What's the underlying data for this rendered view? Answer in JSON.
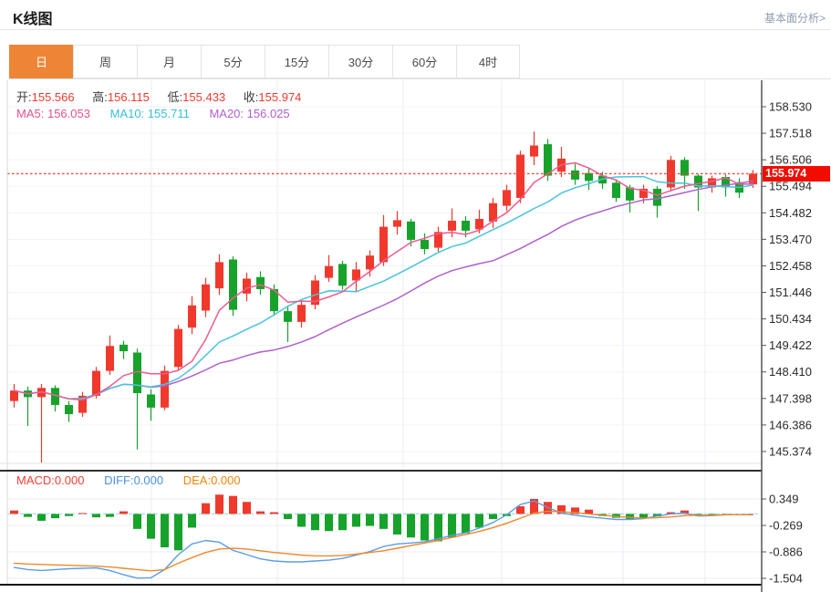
{
  "header": {
    "title": "K线图",
    "link": "基本面分析>"
  },
  "tabs": [
    {
      "label": "日",
      "selected": true
    },
    {
      "label": "周",
      "selected": false
    },
    {
      "label": "月",
      "selected": false
    },
    {
      "label": "5分",
      "selected": false
    },
    {
      "label": "15分",
      "selected": false
    },
    {
      "label": "30分",
      "selected": false
    },
    {
      "label": "60分",
      "selected": false
    },
    {
      "label": "4时",
      "selected": false
    }
  ],
  "ohlc": {
    "o_label": "开:",
    "o": "155.566",
    "h_label": "高:",
    "h": "156.115",
    "l_label": "低:",
    "l": "155.433",
    "c_label": "收:",
    "c": "155.974"
  },
  "ma": {
    "ma5_label": "MA5:",
    "ma5": "156.053",
    "ma10_label": "MA10:",
    "ma10": "155.711",
    "ma20_label": "MA20:",
    "ma20": "156.025"
  },
  "macd_readout": {
    "macd_label": "MACD:",
    "macd": "0.000",
    "diff_label": "DIFF:",
    "diff": "0.000",
    "dea_label": "DEA:",
    "dea": "0.000"
  },
  "price_marker": "155.974",
  "colors": {
    "up": "#f0392c",
    "down": "#17a22b",
    "ma5": "#ee5b90",
    "ma10": "#47c4dc",
    "ma20": "#b05fd0",
    "diff_line": "#5b9de8",
    "dea_line": "#f0882a",
    "marker_bg": "#f20c00",
    "tab_active": "#ee8436",
    "price_dotted_line": "#ff4538",
    "zero_dashed_line": "#a8dcec"
  },
  "chart_data": [
    {
      "type": "candlestick",
      "title": "K线图",
      "y_axis_labels": [
        "158.530",
        "157.518",
        "156.506",
        "155.494",
        "154.482",
        "153.470",
        "152.458",
        "151.446",
        "150.434",
        "149.422",
        "148.410",
        "147.398",
        "146.386",
        "145.374"
      ],
      "ylim": [
        144.9,
        159.5
      ],
      "current_price": 155.974,
      "ma_periods": [
        5,
        10,
        20
      ],
      "candles_ohlc_format": [
        "open",
        "high",
        "low",
        "close"
      ],
      "candles": [
        [
          147.3,
          147.95,
          147.05,
          147.7
        ],
        [
          147.7,
          147.85,
          146.35,
          147.45
        ],
        [
          147.45,
          147.95,
          144.95,
          147.8
        ],
        [
          147.8,
          147.9,
          146.9,
          147.15
        ],
        [
          147.15,
          147.3,
          146.5,
          146.8
        ],
        [
          146.85,
          147.65,
          146.7,
          147.5
        ],
        [
          147.5,
          148.6,
          147.4,
          148.45
        ],
        [
          148.45,
          149.8,
          148.3,
          149.4
        ],
        [
          149.45,
          149.6,
          148.9,
          149.2
        ],
        [
          149.15,
          149.3,
          145.45,
          147.6
        ],
        [
          147.55,
          147.75,
          146.55,
          147.05
        ],
        [
          147.05,
          148.65,
          146.95,
          148.45
        ],
        [
          148.6,
          150.2,
          148.45,
          150.05
        ],
        [
          150.1,
          151.3,
          149.85,
          150.95
        ],
        [
          150.75,
          152.0,
          150.5,
          151.75
        ],
        [
          151.6,
          152.9,
          151.35,
          152.6
        ],
        [
          152.7,
          152.82,
          150.55,
          150.78
        ],
        [
          151.4,
          152.2,
          151.1,
          151.97
        ],
        [
          152.03,
          152.25,
          151.35,
          151.57
        ],
        [
          151.57,
          151.75,
          150.55,
          150.73
        ],
        [
          150.73,
          150.9,
          149.55,
          150.32
        ],
        [
          150.32,
          151.15,
          150.1,
          150.97
        ],
        [
          150.97,
          152.1,
          150.8,
          151.9
        ],
        [
          152.0,
          152.87,
          151.85,
          152.45
        ],
        [
          152.53,
          152.65,
          151.55,
          151.7
        ],
        [
          151.9,
          152.6,
          151.45,
          152.32
        ],
        [
          152.32,
          153.05,
          152.05,
          152.85
        ],
        [
          152.6,
          154.4,
          152.45,
          153.95
        ],
        [
          153.95,
          154.55,
          153.65,
          154.2
        ],
        [
          154.15,
          154.25,
          153.2,
          153.45
        ],
        [
          153.45,
          153.7,
          152.9,
          153.1
        ],
        [
          153.15,
          153.95,
          153.0,
          153.75
        ],
        [
          153.8,
          154.65,
          153.55,
          154.18
        ],
        [
          154.18,
          154.35,
          153.55,
          153.8
        ],
        [
          153.85,
          154.6,
          153.7,
          154.25
        ],
        [
          154.15,
          155.05,
          153.9,
          154.85
        ],
        [
          154.75,
          155.55,
          154.55,
          155.35
        ],
        [
          155.05,
          156.85,
          154.85,
          156.7
        ],
        [
          156.63,
          157.58,
          156.3,
          157.05
        ],
        [
          157.1,
          157.3,
          155.7,
          155.9
        ],
        [
          156.05,
          157.0,
          155.85,
          156.55
        ],
        [
          156.1,
          156.35,
          155.55,
          155.75
        ],
        [
          156.0,
          156.2,
          155.35,
          155.7
        ],
        [
          155.9,
          156.05,
          155.4,
          155.6
        ],
        [
          155.63,
          155.75,
          154.9,
          155.05
        ],
        [
          155.45,
          155.55,
          154.5,
          154.95
        ],
        [
          155.05,
          155.55,
          154.85,
          155.4
        ],
        [
          155.4,
          155.5,
          154.3,
          154.75
        ],
        [
          155.45,
          156.65,
          155.3,
          156.5
        ],
        [
          156.5,
          156.6,
          155.4,
          155.9
        ],
        [
          155.9,
          155.95,
          154.55,
          155.45
        ],
        [
          155.45,
          155.9,
          155.25,
          155.8
        ],
        [
          155.85,
          155.95,
          155.1,
          155.45
        ],
        [
          155.65,
          155.8,
          155.05,
          155.25
        ],
        [
          155.566,
          156.115,
          155.433,
          155.974
        ]
      ]
    },
    {
      "type": "bar",
      "name": "MACD",
      "y_axis_labels": [
        "0.349",
        "-0.269",
        "-0.886",
        "-1.504"
      ],
      "ylim": [
        -1.7,
        0.58
      ],
      "values": [
        0.08,
        -0.07,
        -0.16,
        -0.1,
        -0.05,
        0.02,
        -0.08,
        -0.07,
        0.06,
        -0.35,
        -0.58,
        -0.78,
        -0.85,
        -0.32,
        0.25,
        0.45,
        0.42,
        0.28,
        0.06,
        0.04,
        -0.12,
        -0.3,
        -0.38,
        -0.4,
        -0.38,
        -0.3,
        -0.28,
        -0.35,
        -0.48,
        -0.55,
        -0.62,
        -0.64,
        -0.55,
        -0.45,
        -0.32,
        -0.12,
        -0.05,
        0.18,
        0.35,
        0.28,
        0.2,
        0.15,
        0.1,
        -0.05,
        -0.09,
        -0.12,
        -0.1,
        -0.06,
        0.04,
        0.08,
        -0.04,
        -0.02,
        -0.01,
        0,
        0
      ],
      "diff_values": [
        -1.25,
        -1.3,
        -1.32,
        -1.3,
        -1.28,
        -1.27,
        -1.26,
        -1.32,
        -1.42,
        -1.5,
        -1.49,
        -1.3,
        -0.95,
        -0.7,
        -0.62,
        -0.66,
        -0.85,
        -0.95,
        -1.05,
        -1.1,
        -1.12,
        -1.12,
        -1.1,
        -1.08,
        -1.04,
        -0.96,
        -0.88,
        -0.76,
        -0.7,
        -0.68,
        -0.65,
        -0.58,
        -0.5,
        -0.44,
        -0.33,
        -0.2,
        -0.02,
        0.22,
        0.3,
        0.15,
        0.02,
        -0.03,
        -0.07,
        -0.1,
        -0.13,
        -0.13,
        -0.11,
        -0.05,
        0.0,
        0.02,
        -0.05,
        -0.04,
        -0.02,
        -0.02,
        -0.01
      ],
      "dea_values": [
        -1.15,
        -1.17,
        -1.18,
        -1.19,
        -1.2,
        -1.21,
        -1.22,
        -1.24,
        -1.27,
        -1.3,
        -1.33,
        -1.3,
        -1.15,
        -1.02,
        -0.9,
        -0.82,
        -0.8,
        -0.82,
        -0.86,
        -0.9,
        -0.93,
        -0.96,
        -0.98,
        -0.98,
        -0.97,
        -0.94,
        -0.9,
        -0.86,
        -0.8,
        -0.74,
        -0.68,
        -0.62,
        -0.55,
        -0.48,
        -0.41,
        -0.32,
        -0.22,
        -0.1,
        0.02,
        0.06,
        0.05,
        0.03,
        0.0,
        -0.03,
        -0.06,
        -0.08,
        -0.1,
        -0.09,
        -0.07,
        -0.04,
        -0.03,
        -0.03,
        -0.02,
        -0.02,
        -0.02
      ]
    }
  ]
}
